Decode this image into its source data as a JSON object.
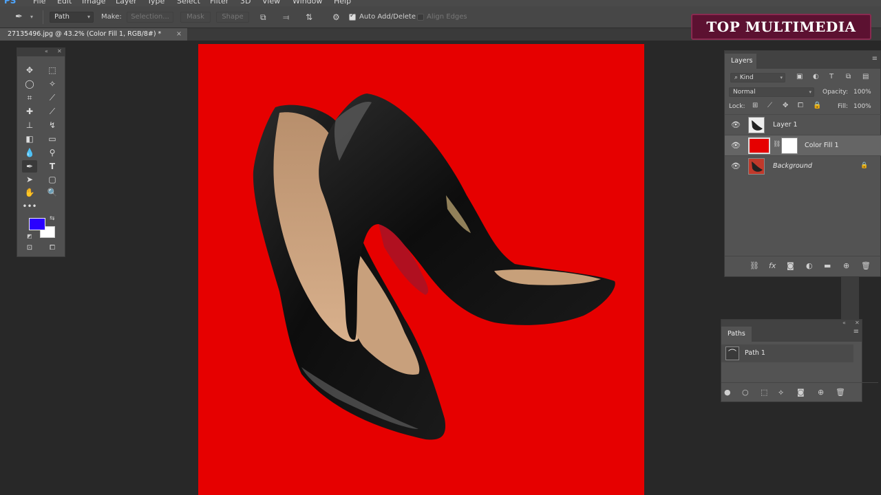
{
  "app": {
    "logo": "PS"
  },
  "menu": [
    "File",
    "Edit",
    "Image",
    "Layer",
    "Type",
    "Select",
    "Filter",
    "3D",
    "View",
    "Window",
    "Help"
  ],
  "options_bar": {
    "tool_mode": "Path",
    "make_label": "Make:",
    "selection_btn": "Selection...",
    "mask_btn": "Mask",
    "shape_btn": "Shape",
    "auto_add_delete": "Auto Add/Delete",
    "auto_add_delete_checked": true,
    "align_edges": "Align Edges",
    "align_edges_checked": false
  },
  "document": {
    "tab_title": "27135496.jpg @ 43.2% (Color Fill 1, RGB/8#) *",
    "close": "×"
  },
  "colors": {
    "foreground": "#2a00ff",
    "background": "#ffffff",
    "canvas_fill": "#e60000"
  },
  "tools": [
    "move",
    "marquee",
    "lasso",
    "magic-wand",
    "crop",
    "eyedropper",
    "healing",
    "brush",
    "stamp",
    "history-brush",
    "eraser",
    "gradient",
    "blur",
    "dodge",
    "pen",
    "type",
    "path-select",
    "rectangle",
    "hand",
    "zoom",
    "more"
  ],
  "watermark": "TOP MULTIMEDIA",
  "layers_panel": {
    "title": "Layers",
    "kind_filter": "Kind",
    "blend_mode": "Normal",
    "opacity_label": "Opacity:",
    "opacity_value": "100%",
    "lock_label": "Lock:",
    "fill_label": "Fill:",
    "fill_value": "100%",
    "layers": [
      {
        "name": "Layer 1",
        "selected": false,
        "italic": false
      },
      {
        "name": "Color Fill 1",
        "selected": true,
        "italic": false
      },
      {
        "name": "Background",
        "selected": false,
        "italic": true
      }
    ]
  },
  "paths_panel": {
    "title": "Paths",
    "paths": [
      {
        "name": "Path 1"
      }
    ]
  }
}
